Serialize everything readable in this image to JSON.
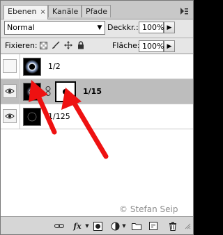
{
  "tabs": [
    {
      "label": "Ebenen",
      "close": "×"
    },
    {
      "label": "Kanäle"
    },
    {
      "label": "Pfade"
    }
  ],
  "blend_mode": {
    "value": "Normal"
  },
  "opacity": {
    "label": "Deckkr.:",
    "value": "100%"
  },
  "lock": {
    "label": "Fixieren:"
  },
  "fill": {
    "label": "Fläche:",
    "value": "100%"
  },
  "layers": [
    {
      "name": "1/2"
    },
    {
      "name": "1/15"
    },
    {
      "name": "1/125"
    }
  ],
  "copyright": "© Stefan Seip",
  "colors": {
    "arrow": "#ee1111",
    "selected_row": "#bdbdbd"
  }
}
